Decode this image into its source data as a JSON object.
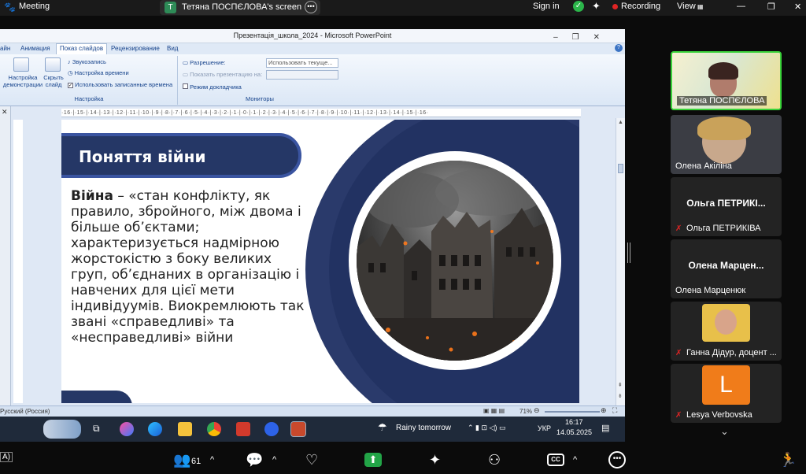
{
  "zoom": {
    "app_title": "Meeting",
    "share_label": "Тетяна ПОСПЄЛОВА's screen",
    "share_initial": "T",
    "sign_in": "Sign in",
    "recording": "Recording",
    "view": "View",
    "participant_count": "61",
    "bottom_left_fragment": "A)"
  },
  "powerpoint": {
    "window_title": "Презентація_школа_2024 - Microsoft PowerPoint",
    "tabs": [
      "айн",
      "Анимация",
      "Показ слайдов",
      "Рецензирование",
      "Вид"
    ],
    "ribbon": {
      "btn_setup": "Настройка демонстрации",
      "btn_hide": "Скрыть слайд",
      "record_narration": "Звукозапись",
      "rehearse": "Настройка времени",
      "use_timings": "Использовать записанные времена",
      "group_setup": "Настройка",
      "resolution_label": "Разрешение:",
      "resolution_value": "Использовать текуще...",
      "show_on_label": "Показать презентацию на:",
      "presenter_view": "Режим докладчика",
      "group_monitors": "Мониторы"
    },
    "ruler": "·16·|·15·|·14·|·13·|·12·|·11·|·10·|·9·|·8·|·7·|·6·|·5·|·4·|·3·|·2·|·1·|·0·|·1·|·2·|·3·|·4·|·5·|·6·|·7·|·8·|·9·|·10·|·11·|·12·|·13·|·14·|·15·|·16·",
    "status_lang": "Русский (Россия)",
    "zoom_level": "71%"
  },
  "slide": {
    "title": "Поняття війни",
    "term": "Війна",
    "definition": " – «стан конфлікту, як правило, збройного, між двома і більше об’єктами; характеризується надмірною жорстокістю з боку великих груп, об’єднаних в організацію і навчених для цієї мети індивідуумів. Виокремлюють так звані «справедливі» та «несправедливі» війни"
  },
  "windows_taskbar": {
    "weather": "Rainy tomorrow",
    "lang": "УКР",
    "time": "16:17",
    "date": "14.05.2025"
  },
  "gallery": [
    {
      "name": "Тетяна ПОСПЄЛОВА",
      "type": "video",
      "active": true
    },
    {
      "name": "Олена Акіліна",
      "type": "video"
    },
    {
      "name": "Ольга ПЕТРИКІВА",
      "big": "Ольга  ПЕТРИКІ...",
      "muted": true
    },
    {
      "name": "Олена Марценюк",
      "big": "Олена  Марцен..."
    },
    {
      "name": "Ганна Дідур, доцент ...",
      "type": "photo",
      "muted": true
    },
    {
      "name": "Lesya Verbovska",
      "initial": "L",
      "muted": true
    }
  ],
  "colors": {
    "slide_navy": "#253766",
    "active_border": "#3ad33a",
    "avatar_orange": "#f07c1a",
    "recording_red": "#e02424"
  }
}
